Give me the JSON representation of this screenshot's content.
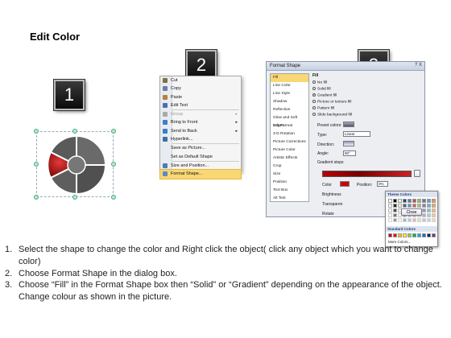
{
  "title": "Edit Color",
  "badges": [
    "1",
    "2",
    "3"
  ],
  "menu": {
    "items": [
      {
        "label": "Cut",
        "icon": "scissors-icon",
        "color": "#8a6d3b",
        "dim": false,
        "arrow": false
      },
      {
        "label": "Copy",
        "icon": "copy-icon",
        "color": "#6b7fa8",
        "dim": false,
        "arrow": false
      },
      {
        "label": "Paste",
        "icon": "paste-icon",
        "color": "#b08040",
        "dim": false,
        "arrow": false
      },
      {
        "label": "Edit Text",
        "icon": "edit-text-icon",
        "color": "#4a6fb0",
        "dim": false,
        "arrow": false
      },
      {
        "label": "Group",
        "icon": "group-icon",
        "color": "#aaaaaa",
        "dim": true,
        "arrow": true
      },
      {
        "label": "Bring to Front",
        "icon": "bring-front-icon",
        "color": "#3a7fc8",
        "dim": false,
        "arrow": true
      },
      {
        "label": "Send to Back",
        "icon": "send-back-icon",
        "color": "#3a7fc8",
        "dim": false,
        "arrow": true
      },
      {
        "label": "Hyperlink...",
        "icon": "hyperlink-icon",
        "color": "#3a6fa8",
        "dim": false,
        "arrow": false
      },
      {
        "label": "Save as Picture...",
        "icon": "",
        "color": "",
        "dim": false,
        "arrow": false
      },
      {
        "label": "Set as Default Shape",
        "icon": "",
        "color": "",
        "dim": false,
        "arrow": false
      },
      {
        "label": "Size and Position...",
        "icon": "size-icon",
        "color": "#4a7fb8",
        "dim": false,
        "arrow": false
      },
      {
        "label": "Format Shape...",
        "icon": "format-shape-icon",
        "color": "#5a8ac8",
        "dim": false,
        "arrow": false,
        "highlight": true
      }
    ]
  },
  "dialog": {
    "title": "Format Shape",
    "title_buttons": "? X",
    "categories": [
      "Fill",
      "Line Color",
      "Line Style",
      "Shadow",
      "Reflection",
      "Glow and Soft Edges",
      "3-D Format",
      "3-D Rotation",
      "Picture Corrections",
      "Picture Color",
      "Artistic Effects",
      "Crop",
      "Size",
      "Position",
      "Text Box",
      "Alt Text"
    ],
    "fill_heading": "Fill",
    "fill_options": [
      {
        "label": "No fill",
        "selected": false
      },
      {
        "label": "Solid fill",
        "selected": false
      },
      {
        "label": "Gradient fill",
        "selected": true
      },
      {
        "label": "Picture or texture fill",
        "selected": false
      },
      {
        "label": "Pattern fill",
        "selected": false
      },
      {
        "label": "Slide background fill",
        "selected": false
      }
    ],
    "preset_label": "Preset colors:",
    "type_label": "Type:",
    "type_value": "Linear",
    "direction_label": "Direction:",
    "angle_label": "Angle:",
    "angle_value": "90°",
    "stops_label": "Gradient stops",
    "color_label": "Color",
    "position_label": "Position:",
    "position_value": "0%",
    "brightness_label": "Brightness",
    "transparency_label": "Transparen",
    "rotate_label": "Rotate",
    "theme_colors_label": "Theme Colors",
    "standard_colors_label": "Standard Colors",
    "more_colors_label": "More Colors...",
    "close_label": "Close"
  },
  "theme_colors": [
    "#ffffff",
    "#000000",
    "#eeece1",
    "#1f497d",
    "#4f81bd",
    "#c0504d",
    "#9bbb59",
    "#8064a2",
    "#4bacc6",
    "#f79646"
  ],
  "standard_colors": [
    "#c00000",
    "#ff0000",
    "#ffc000",
    "#ffff00",
    "#92d050",
    "#00b050",
    "#00b0f0",
    "#0070c0",
    "#002060",
    "#7030a0"
  ],
  "instructions": [
    {
      "num": "1.",
      "text": "Select the shape to change the color and Right click the object( click any object which you want to change color)"
    },
    {
      "num": "2.",
      "text": "Choose Format Shape in the dialog box."
    },
    {
      "num": "3.",
      "text": "Choose “Fill” in the Format Shape box then “Solid” or “Gradient” depending on the appearance of the object. Change colour as shown in the picture."
    }
  ]
}
